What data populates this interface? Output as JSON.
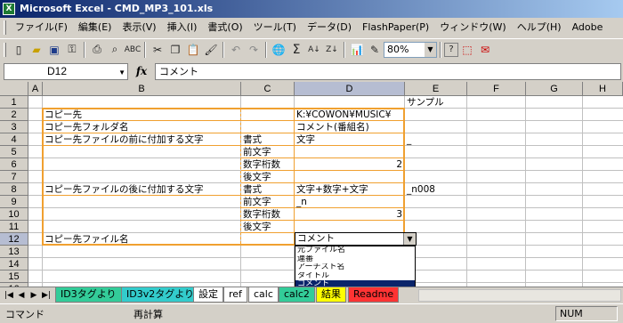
{
  "window": {
    "title": "Microsoft Excel - CMD_MP3_101.xls",
    "app_icon": "excel-icon"
  },
  "menu": [
    "ファイル(F)",
    "編集(E)",
    "表示(V)",
    "挿入(I)",
    "書式(O)",
    "ツール(T)",
    "データ(D)",
    "FlashPaper(P)",
    "ウィンドウ(W)",
    "ヘルプ(H)",
    "Adobe"
  ],
  "toolbar": {
    "icons": [
      "new-icon",
      "open-icon",
      "save-icon",
      "permission-icon",
      "print-icon",
      "print-preview-icon",
      "spellcheck-icon",
      "cut-icon",
      "copy-icon",
      "paste-icon",
      "format-painter-icon",
      "undo-icon",
      "redo-icon",
      "hyperlink-icon",
      "autosum-icon",
      "sort-asc-icon",
      "sort-desc-icon",
      "chart-wizard-icon",
      "drawing-icon"
    ],
    "zoom": "80%",
    "help_icon": "help-icon",
    "pdf_icons": [
      "pdf-icon",
      "pdf-mail-icon"
    ]
  },
  "formula_bar": {
    "name_box": "D12",
    "fx": "fx",
    "value": "コメント"
  },
  "columns": [
    "A",
    "B",
    "C",
    "D",
    "E",
    "F",
    "G",
    "H"
  ],
  "rows": [
    "1",
    "2",
    "3",
    "4",
    "5",
    "6",
    "7",
    "8",
    "9",
    "10",
    "11",
    "12",
    "13",
    "14",
    "15",
    "16",
    "17"
  ],
  "cells": {
    "E1": "サンプル",
    "B2": "コピー先",
    "D2": "K:¥COWON¥MUSIC¥",
    "B3": "コピー先フォルダ名",
    "D3": "コメント(番組名)",
    "B4": "コピー先ファイルの前に付加する文字",
    "C4": "書式",
    "D4": "文字",
    "E4": "_",
    "C5": "前文字",
    "C6": "数字桁数",
    "D6": "2",
    "C7": "後文字",
    "B8": "コピー先ファイルの後に付加する文字",
    "C8": "書式",
    "D8": "文字+数字+文字",
    "E8": "_n008",
    "C9": "前文字",
    "D9": "_n",
    "C10": "数字桁数",
    "D10": "3",
    "C11": "後文字",
    "B12": "コピー先ファイル名",
    "D12": "コメント"
  },
  "dropdown": {
    "options": [
      "元ファイル名",
      "連番",
      "アーチスト名",
      "タイトル",
      "コメント"
    ],
    "selected_index": 4
  },
  "sheet_tabs": [
    {
      "label": "ID3タグより",
      "color": "#33cc99"
    },
    {
      "label": "ID3v2タグより",
      "color": "#33cccc"
    },
    {
      "label": "設定",
      "color": "#ffffff"
    },
    {
      "label": "ref",
      "color": "#ffffff"
    },
    {
      "label": "calc",
      "color": "#ffffff"
    },
    {
      "label": "calc2",
      "color": "#33cc99"
    },
    {
      "label": "結果",
      "color": "#ffff00"
    },
    {
      "label": "Readme",
      "color": "#ff3333"
    }
  ],
  "status": {
    "left": "コマンド",
    "middle": "再計算",
    "right": "NUM"
  }
}
